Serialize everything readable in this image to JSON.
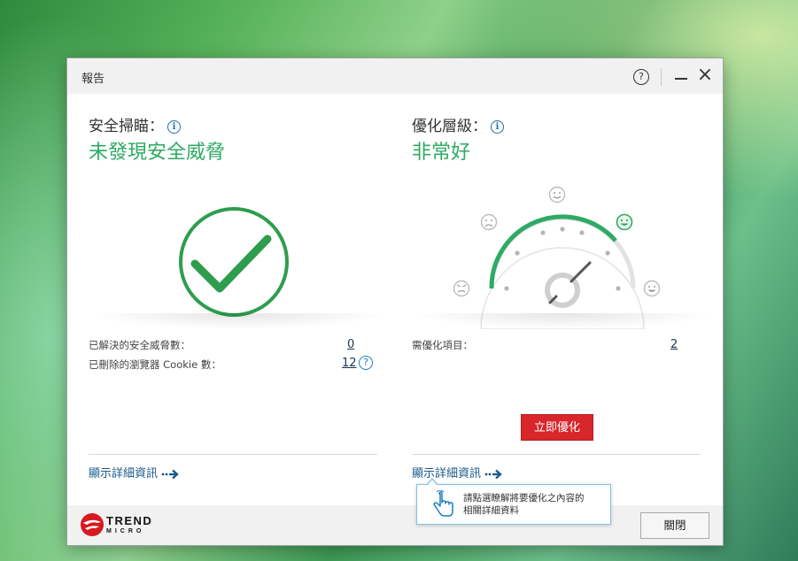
{
  "window": {
    "title": "報告",
    "help_glyph": "?",
    "close_glyph": "×"
  },
  "security": {
    "heading": "安全掃瞄：",
    "status": "未發現安全威脅",
    "status_color": "#2eaa64",
    "rows": [
      {
        "label": "已解決的安全威脅數：",
        "value": "0"
      },
      {
        "label": "已刪除的瀏覽器 Cookie 數：",
        "value": "12"
      }
    ],
    "details_link": "顯示詳細資訊"
  },
  "optimization": {
    "heading": "優化層級：",
    "status": "非常好",
    "gauge_level": 0.8,
    "rows": [
      {
        "label": "需優化項目：",
        "value": "2"
      }
    ],
    "optimize_button": "立即優化",
    "details_link": "顯示詳細資訊"
  },
  "tooltip": {
    "text": "請點選瞭解將要優化之內容的\n相關詳細資料"
  },
  "footer": {
    "logo_main": "TREND",
    "logo_sub": "MICRO",
    "close_button": "關閉"
  },
  "colors": {
    "accent_green": "#2eaa64",
    "link_blue": "#1a5a8a",
    "button_red": "#d8262b"
  }
}
